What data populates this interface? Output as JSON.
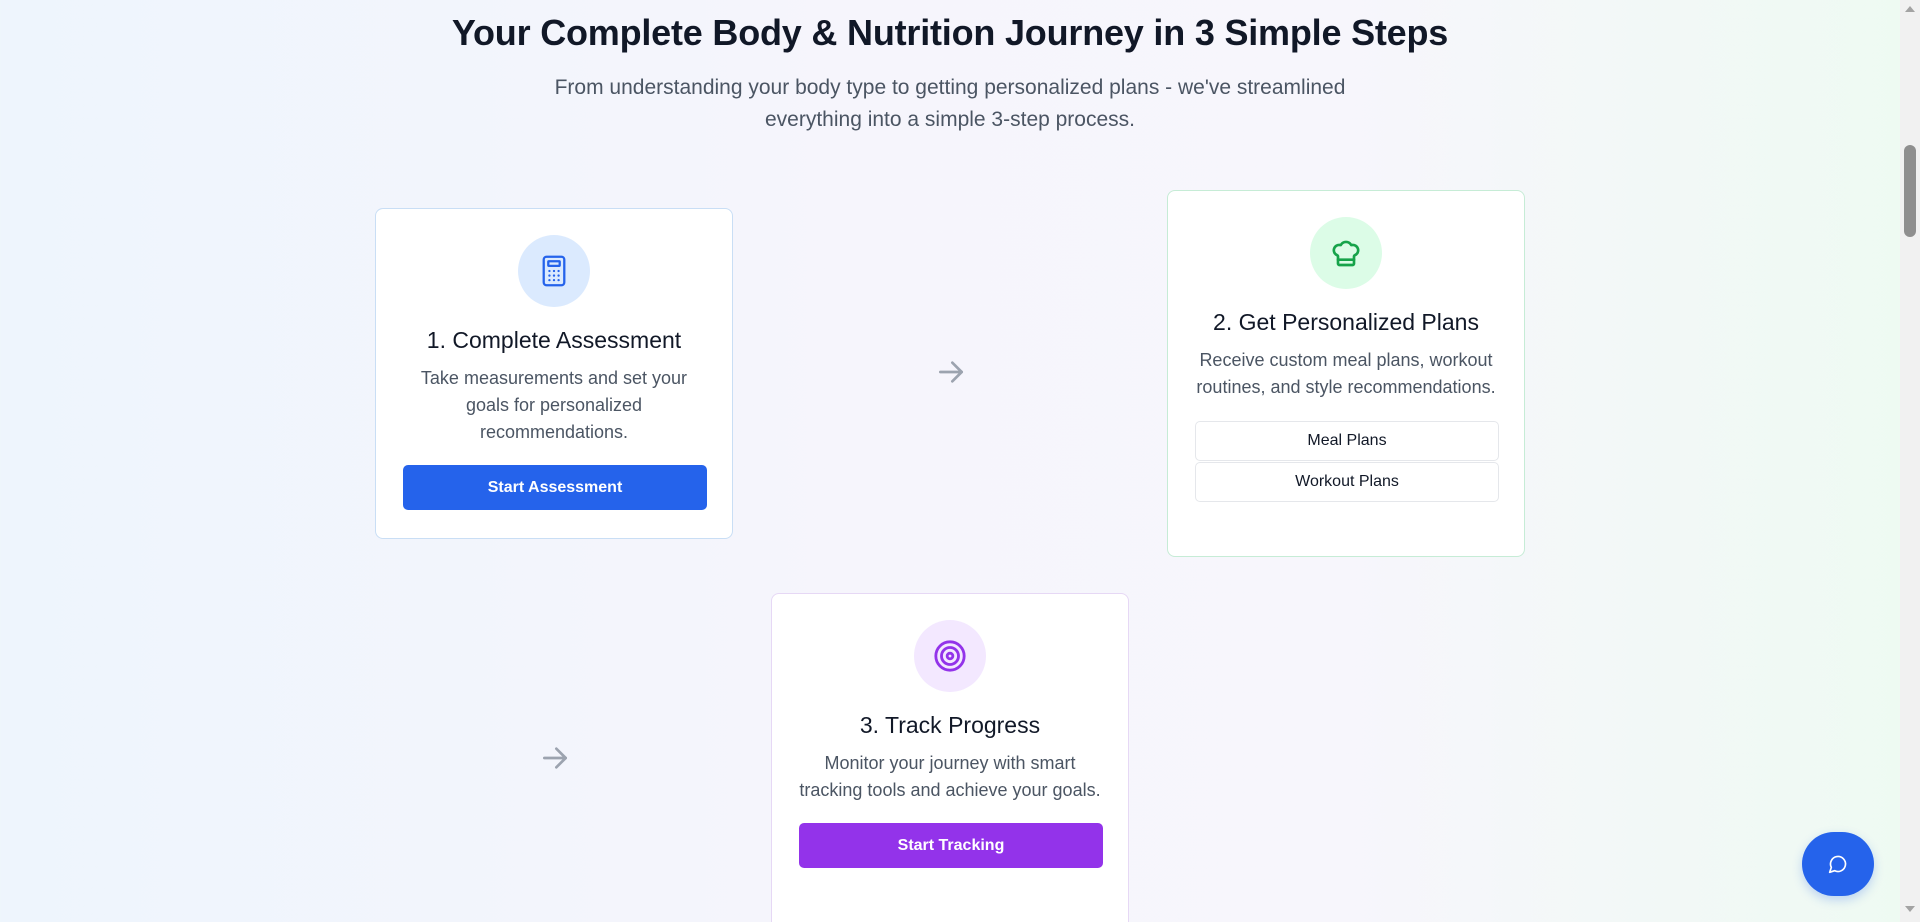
{
  "header": {
    "title": "Your Complete Body & Nutrition Journey in 3 Simple Steps",
    "subtitle": "From understanding your body type to getting personalized plans - we've streamlined everything into a simple 3-step process."
  },
  "steps": [
    {
      "icon": "calculator-icon",
      "title": "1. Complete Assessment",
      "description": "Take measurements and set your goals for personalized recommendations.",
      "button_label": "Start Assessment",
      "accent": "#2563eb"
    },
    {
      "icon": "chef-hat-icon",
      "title": "2. Get Personalized Plans",
      "description": "Receive custom meal plans, workout routines, and style recommendations.",
      "buttons": [
        "Meal Plans",
        "Workout Plans"
      ],
      "accent": "#16a34a"
    },
    {
      "icon": "target-icon",
      "title": "3. Track Progress",
      "description": "Monitor your journey with smart tracking tools and achieve your goals.",
      "button_label": "Start Tracking",
      "accent": "#9333ea"
    }
  ],
  "connectors": [
    "arrow-right-icon",
    "arrow-right-icon"
  ],
  "chat": {
    "icon": "chat-bubble-icon",
    "color": "#2563eb"
  }
}
